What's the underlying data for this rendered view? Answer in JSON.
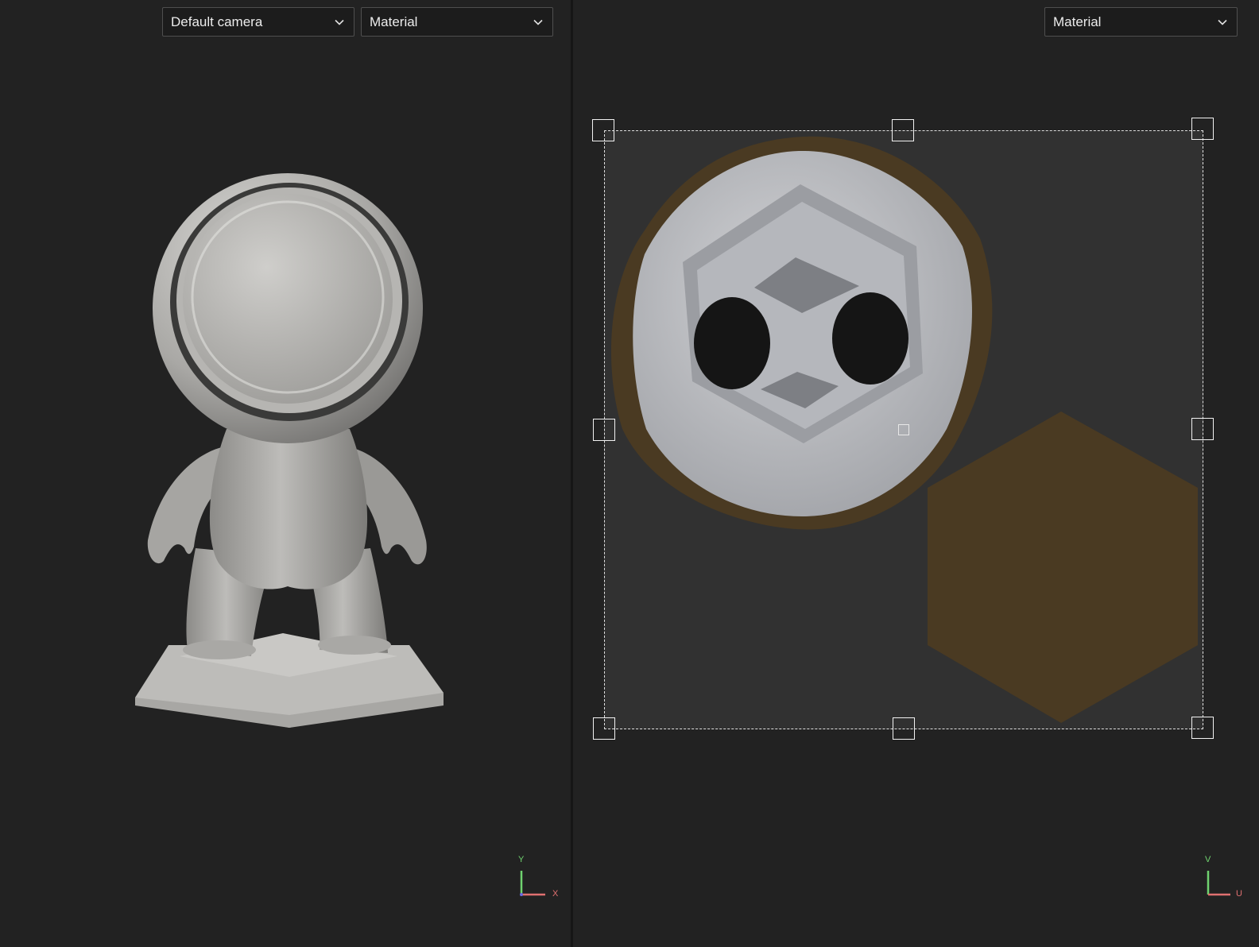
{
  "viewport_3d": {
    "camera_dropdown": {
      "value": "Default camera",
      "icon": "chevron-down-icon"
    },
    "mode_dropdown": {
      "value": "Material",
      "icon": "chevron-down-icon"
    },
    "axis_gizmo": {
      "y_label": "Y",
      "x_label": "X"
    }
  },
  "viewport_uv": {
    "mode_dropdown": {
      "value": "Material",
      "icon": "chevron-down-icon"
    },
    "axis_gizmo": {
      "v_label": "V",
      "u_label": "U"
    }
  },
  "colors": {
    "background": "#222222",
    "uv_island_highlight": "#4a3a22",
    "axis_y_green": "#6fd26f",
    "axis_x_red": "#e07070"
  }
}
